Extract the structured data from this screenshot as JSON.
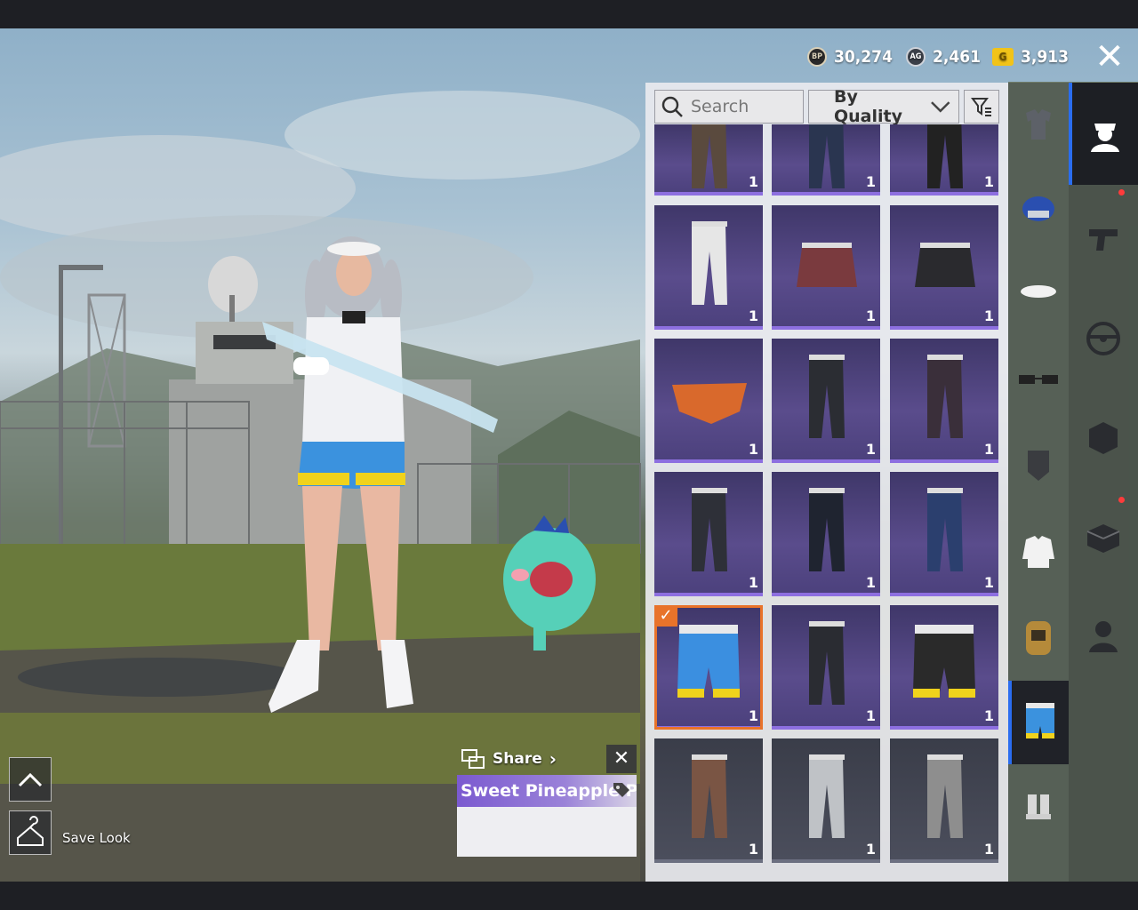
{
  "currency": [
    {
      "icon": "bp-coin-icon",
      "icon_text": "BP",
      "value": "30,274"
    },
    {
      "icon": "ag-coin-icon",
      "icon_text": "AG",
      "value": "2,461"
    },
    {
      "icon": "g-coin-icon",
      "icon_text": "G",
      "value": "3,913"
    }
  ],
  "search": {
    "placeholder": "Search"
  },
  "sort": {
    "label": "By Quality"
  },
  "inventory": {
    "items": [
      {
        "kind": "pants",
        "color": "#5a4a3e",
        "qty": "1",
        "rarity": "purple"
      },
      {
        "kind": "pants",
        "color": "#2a3550",
        "qty": "1",
        "rarity": "purple"
      },
      {
        "kind": "pants",
        "color": "#222",
        "qty": "1",
        "rarity": "purple"
      },
      {
        "kind": "pants",
        "color": "#e6e6e6",
        "qty": "1",
        "rarity": "purple"
      },
      {
        "kind": "skirt",
        "color": "#7a3a3e",
        "qty": "1",
        "rarity": "purple"
      },
      {
        "kind": "skirt",
        "color": "#2a2a2e",
        "qty": "1",
        "rarity": "purple"
      },
      {
        "kind": "briefs",
        "color": "#d9692c",
        "qty": "1",
        "rarity": "purple"
      },
      {
        "kind": "pants",
        "color": "#2b2d33",
        "qty": "1",
        "rarity": "purple"
      },
      {
        "kind": "pants",
        "color": "#3a2f3a",
        "qty": "1",
        "rarity": "purple"
      },
      {
        "kind": "pants",
        "color": "#2e3038",
        "qty": "1",
        "rarity": "purple"
      },
      {
        "kind": "pants",
        "color": "#1f2430",
        "qty": "1",
        "rarity": "purple"
      },
      {
        "kind": "pants",
        "color": "#2b3f6e",
        "qty": "1",
        "rarity": "purple"
      },
      {
        "kind": "shorts",
        "color": "#3b8fe0",
        "qty": "1",
        "rarity": "purple",
        "selected": true
      },
      {
        "kind": "pants",
        "color": "#2a2c32",
        "qty": "1",
        "rarity": "purple"
      },
      {
        "kind": "shorts",
        "color": "#2a2a2a",
        "qty": "1",
        "rarity": "purple"
      },
      {
        "kind": "pants",
        "color": "#7a5544",
        "qty": "1",
        "rarity": "grey"
      },
      {
        "kind": "pants",
        "color": "#bfc2c6",
        "qty": "1",
        "rarity": "grey"
      },
      {
        "kind": "pants",
        "color": "#8e8e8e",
        "qty": "1",
        "rarity": "grey"
      }
    ]
  },
  "share": {
    "label": "Share",
    "item_name": "Sweet Pineapple Pa"
  },
  "save_look": {
    "label": "Save Look"
  }
}
